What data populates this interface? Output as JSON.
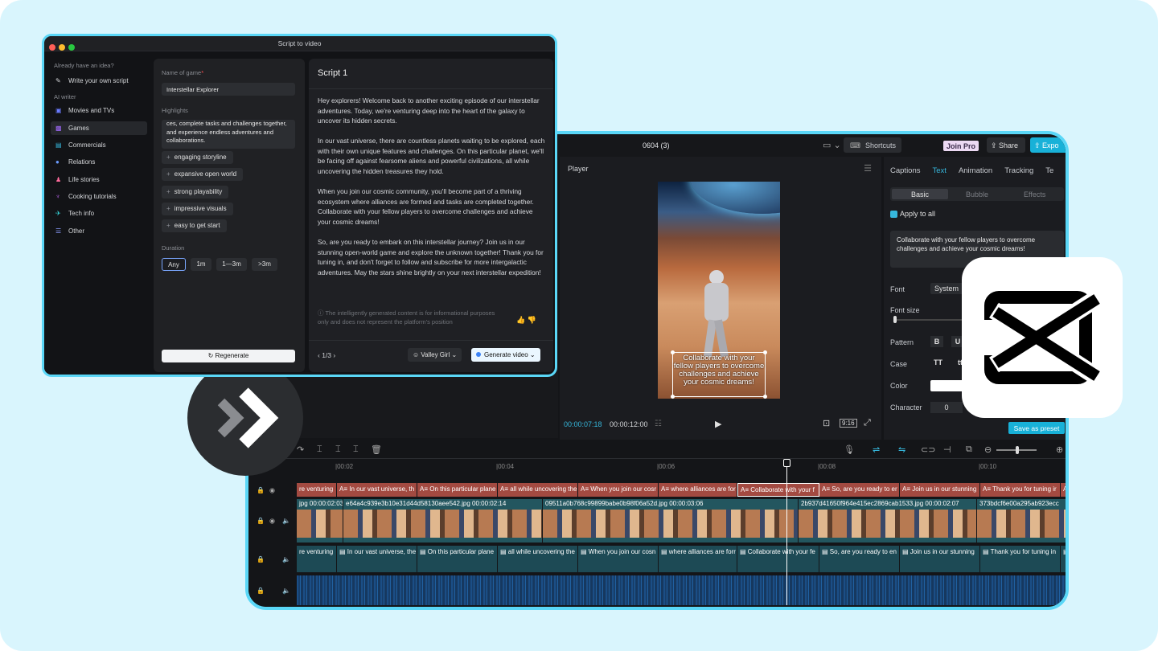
{
  "editor": {
    "title": "0604 (3)",
    "shortcuts": "Shortcuts",
    "join_pro": "Join Pro",
    "share": "Share",
    "export": "Expo",
    "player_label": "Player",
    "caption_text": "Collaborate with your fellow players to overcome challenges and achieve your cosmic dreams!",
    "time_current": "00:00:07:18",
    "time_total": "00:00:12:00",
    "ratio": "9:16",
    "panel_tabs": [
      "Captions",
      "Text",
      "Animation",
      "Tracking",
      "Te"
    ],
    "sub_tabs": [
      "Basic",
      "Bubble",
      "Effects"
    ],
    "apply_all": "Apply to all",
    "text_value": "Collaborate with your fellow players to overcome challenges and achieve your cosmic dreams!",
    "labels": {
      "font": "Font",
      "font_size": "Font size",
      "pattern": "Pattern",
      "case": "Case",
      "color": "Color",
      "character": "Character"
    },
    "font_value": "System",
    "bold": "B",
    "underline": "U",
    "case_tt": "TT",
    "case_tt2": "tt",
    "char_value": "0",
    "save_preset": "Save as preset",
    "ruler": [
      "|00:02",
      "|00:04",
      "|00:06",
      "|00:08",
      "|00:10"
    ],
    "caption_clips": [
      "re venturing",
      "A≡ In our vast universe, th",
      "A≡ On this particular plane",
      "A≡ all while uncovering the",
      "A≡ When you join our cosr",
      "A≡ where alliances are for",
      "A≡ Collaborate with your f",
      "A≡ So, are you ready to er",
      "A≡ Join us in our stunning",
      "A≡ Thank you for tuning ir",
      "A≡"
    ],
    "video_clips": [
      "jpg  00:00:02:03",
      "e64a4c939e3b10e31d44d58130aee542.jpg  00:00:02:14",
      "09511a0b768c99899babe0b98f06a52d.jpg  00:00:03:06",
      "2b937d41650f964e415ec2869cab1533.jpg  00:00:02:07",
      "373bdcf6e00a295ab923ecc"
    ],
    "text_clips": [
      "re venturing",
      "▤ In our vast universe, the",
      "▤ On this particular plane",
      "▤ all while uncovering the",
      "▤ When you join our cosn",
      "▤ where alliances are forr",
      "▤ Collaborate with your fe",
      "▤ So, are you ready to en",
      "▤ Join us in our stunning",
      "▤ Thank you for tuning in",
      "▤"
    ]
  },
  "script": {
    "window_title": "Script to video",
    "side_heading_1": "Already have an idea?",
    "write_own": "Write your own script",
    "side_heading_2": "AI writer",
    "categories": [
      "Movies and TVs",
      "Games",
      "Commercials",
      "Relations",
      "Life stories",
      "Cooking tutorials",
      "Tech info",
      "Other"
    ],
    "name_label": "Name of game",
    "name_value": "Interstellar Explorer",
    "highlights_label": "Highlights",
    "highlights_text": "ces, complete tasks and challenges together, and experience endless adventures and collaborations.",
    "chips": [
      "engaging storyline",
      "expansive open world",
      "strong playability",
      "impressive visuals",
      "easy to get start"
    ],
    "duration_label": "Duration",
    "durations": [
      "Any",
      "1m",
      "1—3m",
      ">3m"
    ],
    "regenerate": "Regenerate",
    "script_title": "Script 1",
    "paragraphs": [
      "Hey explorers! Welcome back to another exciting episode of our interstellar adventures. Today, we're venturing deep into the heart of the galaxy to uncover its hidden secrets.",
      "In our vast universe, there are countless planets waiting to be explored, each with their own unique features and challenges. On this particular planet, we'll be facing off against fearsome aliens and powerful civilizations, all while uncovering the hidden treasures they hold.",
      "When you join our cosmic community, you'll become part of a thriving ecosystem where alliances are formed and tasks are completed together. Collaborate with your fellow players to overcome challenges and achieve your cosmic dreams!",
      "So, are you ready to embark on this interstellar journey? Join us in our stunning open-world game and explore the unknown together! Thank you for tuning in, and don't forget to follow and subscribe for more intergalactic adventures. May the stars shine brightly on your next interstellar expedition!"
    ],
    "notice": "The intelligently generated content is for informational purposes only and does not represent the platform's position",
    "pager": "1/3",
    "voice": "Valley Girl",
    "generate": "Generate video"
  }
}
